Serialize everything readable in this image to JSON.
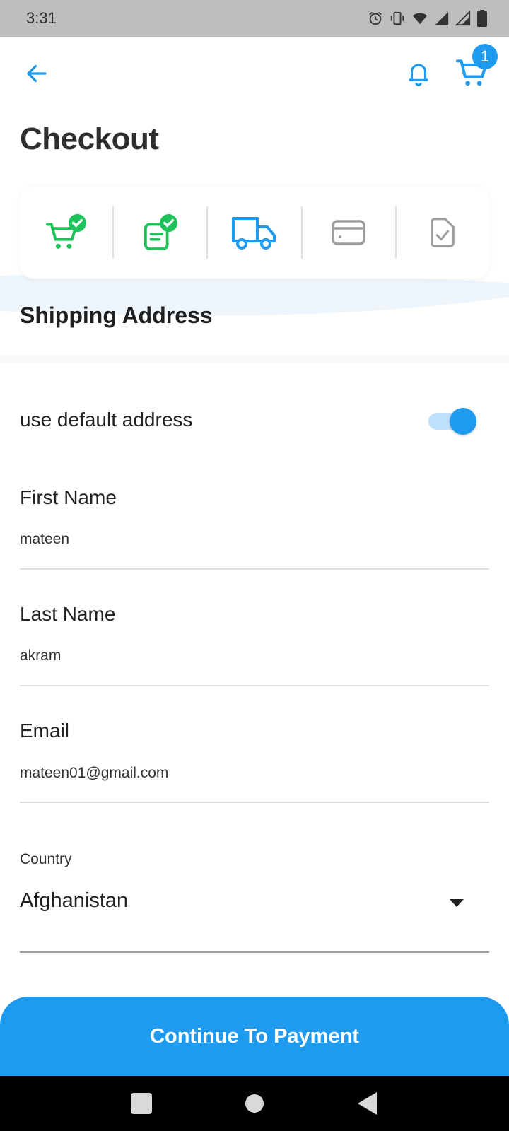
{
  "status_bar": {
    "time": "3:31",
    "icons": [
      "alarm-icon",
      "vibrate-icon",
      "wifi-icon",
      "signal-icon",
      "signal-icon",
      "battery-icon"
    ]
  },
  "app_bar": {
    "back_icon": "arrow-left-icon",
    "bell_icon": "bell-icon",
    "cart_icon": "cart-icon",
    "cart_count": "1"
  },
  "page": {
    "title": "Checkout"
  },
  "steps": [
    {
      "icon": "cart-check-icon",
      "state": "done"
    },
    {
      "icon": "clipboard-check-icon",
      "state": "done"
    },
    {
      "icon": "truck-icon",
      "state": "active"
    },
    {
      "icon": "credit-card-icon",
      "state": "pending"
    },
    {
      "icon": "document-check-icon",
      "state": "pending"
    }
  ],
  "section": {
    "title": "Shipping Address"
  },
  "default_address": {
    "label": "use default address",
    "enabled": true
  },
  "fields": {
    "first_name": {
      "label": "First Name",
      "value": "mateen"
    },
    "last_name": {
      "label": "Last Name",
      "value": "akram"
    },
    "email": {
      "label": "Email",
      "value": "mateen01@gmail.com"
    }
  },
  "country": {
    "label": "Country",
    "value": "Afghanistan"
  },
  "continue_button": {
    "label": "Continue To Payment"
  },
  "colors": {
    "accent": "#1e9bef",
    "done": "#1dc25b",
    "pending": "#9e9e9e"
  },
  "nav_bar": {
    "buttons": [
      "recents-icon",
      "home-icon",
      "back-icon"
    ]
  }
}
